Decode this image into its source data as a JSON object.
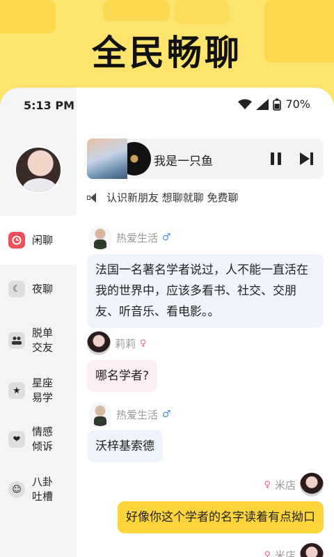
{
  "banner": {
    "title": "全民畅聊"
  },
  "status_bar": {
    "time": "5:13 PM",
    "battery": "70%",
    "wifi_icon": "wifi-icon",
    "signal_icon": "signal-icon",
    "battery_icon": "battery-icon"
  },
  "sidebar": {
    "items": [
      {
        "label": "闲聊",
        "icon": "chat-icon",
        "active": true
      },
      {
        "label": "夜聊",
        "icon": "moon-icon",
        "active": false
      },
      {
        "label": "脱单\n交友",
        "icon": "people-icon",
        "active": false
      },
      {
        "label": "星座\n易学",
        "icon": "star-icon",
        "active": false
      },
      {
        "label": "情感\n倾诉",
        "icon": "heart-icon",
        "active": false
      },
      {
        "label": "八卦\n吐槽",
        "icon": "smile-icon",
        "active": false
      }
    ]
  },
  "music": {
    "title": "我是一只鱼"
  },
  "notice": {
    "text": "认识新朋友 想聊就聊 免费聊"
  },
  "messages": [
    {
      "user": "热爱生活",
      "gender": "♂",
      "text": "法国一名著名学者说过，人不能一直活在我的世界中，应该多看书、社交、交朋友、听音乐、看电影。。"
    },
    {
      "user": "莉莉",
      "gender": "♀",
      "text": "哪名学者?"
    },
    {
      "user": "热爱生活",
      "gender": "♂",
      "text": "沃梓基索德"
    },
    {
      "user": "米店",
      "gender": "♀",
      "text": "好像你这个学者的名字读着有点拗口"
    },
    {
      "user": "米店",
      "gender": "♀",
      "text": ""
    }
  ],
  "colors": {
    "banner": "#fde46c",
    "accent_red": "#ef4f58",
    "self_bubble": "#fcd53a",
    "other_bubble": "#eef3fc",
    "female_bubble": "#fdeef2"
  }
}
